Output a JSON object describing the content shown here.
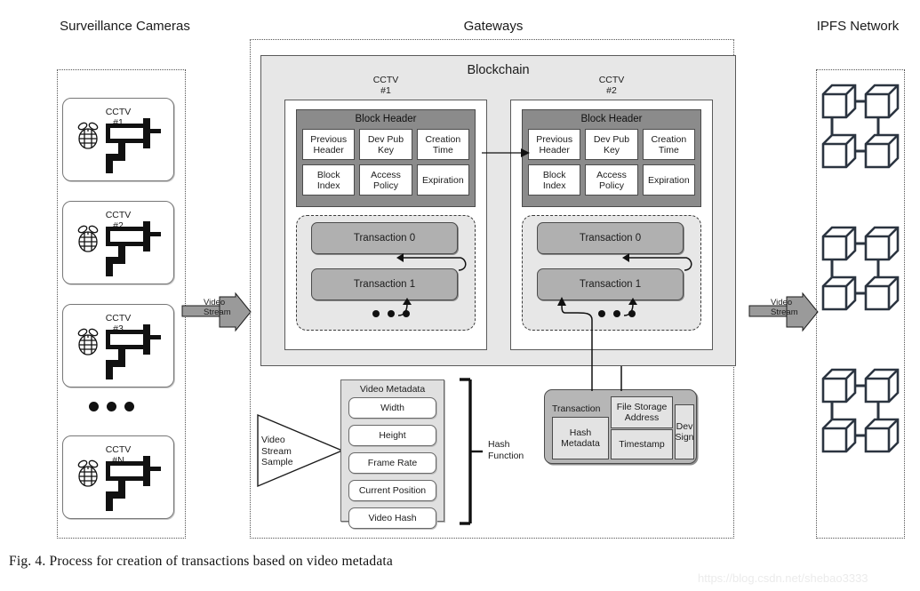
{
  "figure": {
    "caption": "Fig. 4.  Process for creation of transactions based on video metadata",
    "watermark": "https://blog.csdn.net/shebao3333"
  },
  "columns": {
    "cameras_title": "Surveillance\nCameras",
    "gateways_title": "Gateways",
    "ipfs_title": "IPFS\nNetwork"
  },
  "cameras": {
    "items": [
      {
        "label": "CCTV\n#1"
      },
      {
        "label": "CCTV\n#2"
      },
      {
        "label": "CCTV\n#3"
      },
      {
        "label": "CCTV\n#N"
      }
    ],
    "ellipsis": "● ● ●"
  },
  "arrows": {
    "left_stream": "Video\nStream",
    "right_stream": "Video\nStream"
  },
  "blockchain": {
    "title": "Blockchain",
    "blocks": [
      {
        "caption": "CCTV\n#1",
        "header_title": "Block Header",
        "header_cells": [
          "Previous\nHeader",
          "Dev Pub\nKey",
          "Creation\nTime",
          "Block\nIndex",
          "Access\nPolicy",
          "Expiration"
        ],
        "transactions": [
          "Transaction 0",
          "Transaction 1"
        ]
      },
      {
        "caption": "CCTV\n#2",
        "header_title": "Block Header",
        "header_cells": [
          "Previous\nHeader",
          "Dev Pub\nKey",
          "Creation\nTime",
          "Block\nIndex",
          "Access\nPolicy",
          "Expiration"
        ],
        "transactions": [
          "Transaction 0",
          "Transaction 1"
        ]
      }
    ]
  },
  "video_sample": {
    "label": "Video\nStream\nSample"
  },
  "video_metadata": {
    "title": "Video Metadata",
    "items": [
      "Width",
      "Height",
      "Frame Rate",
      "Current Position",
      "Video Hash"
    ]
  },
  "hash_function": {
    "label": "Hash\nFunction"
  },
  "transaction_detail": {
    "title": "Transaction",
    "hash_metadata": "Hash\nMetadata",
    "file_storage_address": "File Storage\nAddress",
    "timestamp": "Timestamp",
    "dev_sign": "Dev\nSign"
  },
  "ipfs": {
    "cluster_count": 3,
    "nodes_per_cluster": 4
  },
  "colors": {
    "block_header_fill": "#8b8b8b",
    "transaction_fill": "#b0b0b0",
    "blockchain_fill": "#e7e7e7",
    "metadata_fill": "#e0e0e0",
    "line": "#333333"
  }
}
